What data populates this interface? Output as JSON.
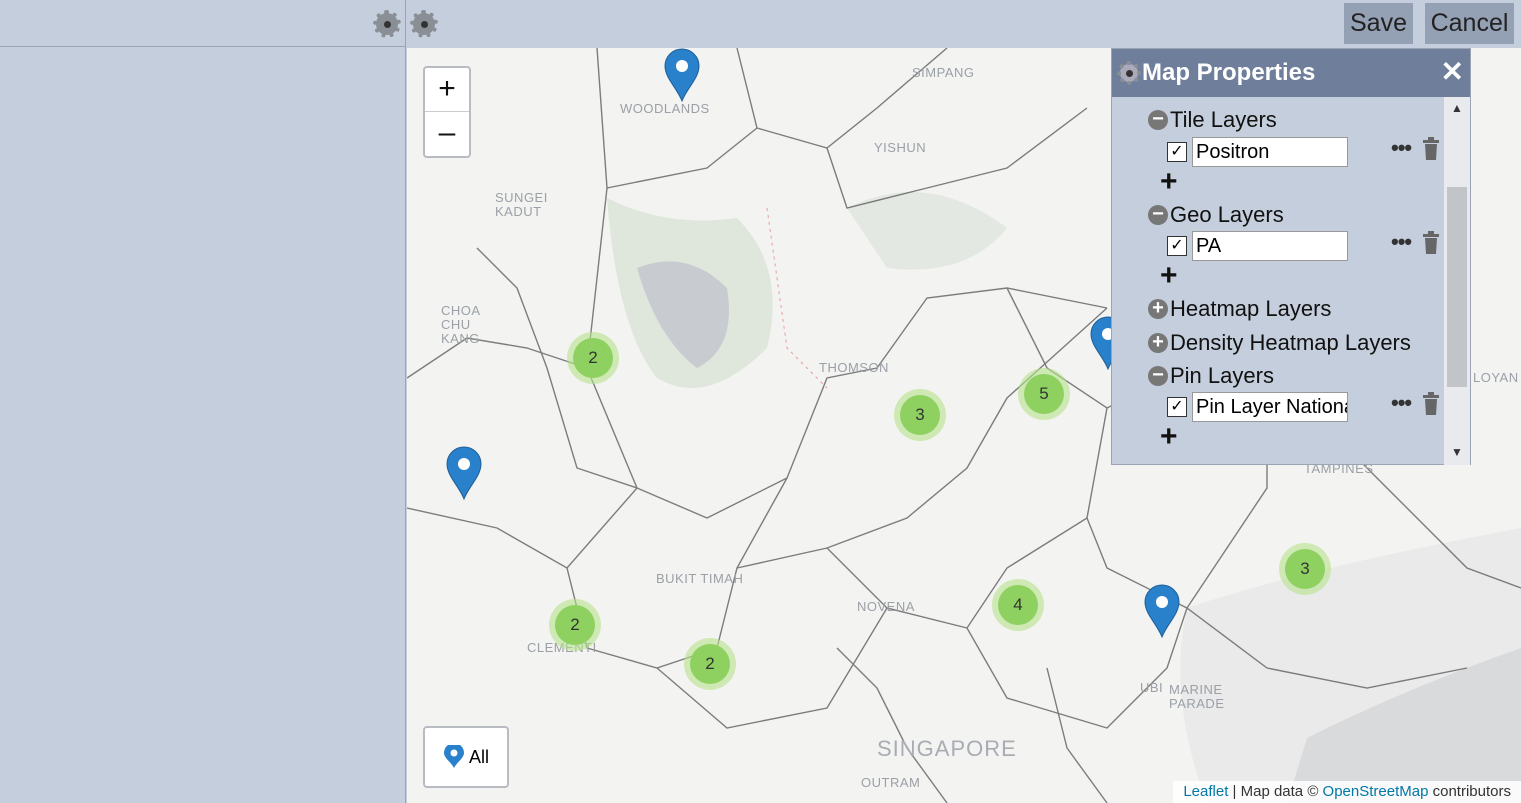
{
  "toolbar": {
    "save_label": "Save",
    "cancel_label": "Cancel"
  },
  "map": {
    "labels": [
      "SIMPANG",
      "WOODLANDS",
      "YISHUN",
      "SUNGEI KADUT",
      "CHOA CHU KANG",
      "THOMSON",
      "BUKIT TIMAH",
      "NOVENA",
      "CLEMENTI",
      "UBI",
      "MARINE PARADE",
      "TAMPINES",
      "SINGAPORE",
      "OUTRAM",
      "LOYAN"
    ],
    "clusters": [
      "2",
      "3",
      "5",
      "2",
      "2",
      "4",
      "3"
    ],
    "all_label": "All",
    "zoom_in": "+",
    "zoom_out": "–",
    "attribution": {
      "leaflet": "Leaflet",
      "sep": " | Map data © ",
      "osm": "OpenStreetMap",
      "suffix": " contributors"
    }
  },
  "panel": {
    "title": "Map Properties",
    "close": "✕",
    "sections": [
      {
        "label": "Tile Layers",
        "toggle": "−",
        "items": [
          "Positron"
        ]
      },
      {
        "label": "Geo Layers",
        "toggle": "−",
        "items": [
          "PA"
        ]
      },
      {
        "label": "Heatmap Layers",
        "toggle": "+"
      },
      {
        "label": "Density Heatmap Layers",
        "toggle": "+"
      },
      {
        "label": "Pin Layers",
        "toggle": "−",
        "items": [
          "Pin Layer National"
        ]
      }
    ]
  },
  "colors": {
    "accent": "#6f7e9a",
    "background": "#c5cedc",
    "cluster": "#8fd160",
    "pin": "#2a81cb"
  }
}
